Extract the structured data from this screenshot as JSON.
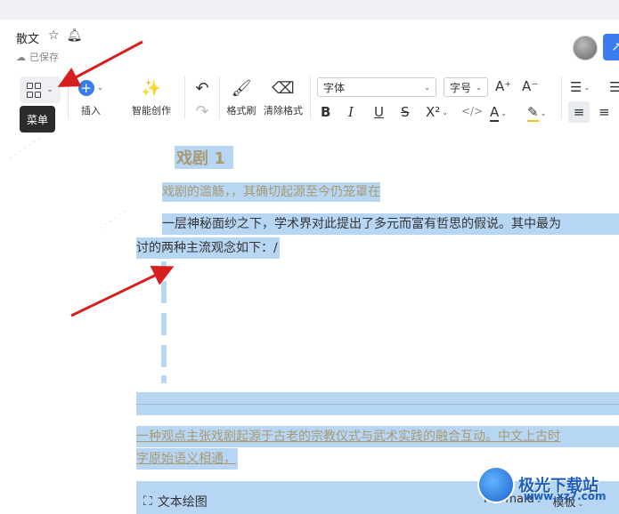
{
  "header": {
    "doc_title": "散文",
    "saved_status": "已保存"
  },
  "toolbar": {
    "menu_tooltip": "菜单",
    "insert_label": "插入",
    "ai_label": "智能创作",
    "format_painter_label": "格式刷",
    "clear_format_label": "清除格式",
    "font_select": "字体",
    "size_select": "字号"
  },
  "document": {
    "heading": "戏剧 1",
    "line1": "戏剧的滥觞，，其确切起源至今仍笼罩在",
    "line2": "一层神秘面纱之下，学术界对此提出了多元而富有哲思的假说。其中最为",
    "line3": "讨的两种主流观念如下：/",
    "line4": "一种观点主张戏剧起源于古老的宗教仪式与武术实践的融合互动。中文上古时",
    "line5": "字原始语义相通，",
    "block_label": "文本绘图",
    "block_type": "Mermaid",
    "block_template": "模板"
  },
  "watermark": {
    "brand": "极光下载站",
    "site": "www.xz7.com"
  },
  "colors": {
    "accent": "#3a7cf0",
    "selection": "#b7d6f4",
    "heading_text": "#a99a72",
    "arrow": "#d62020"
  }
}
